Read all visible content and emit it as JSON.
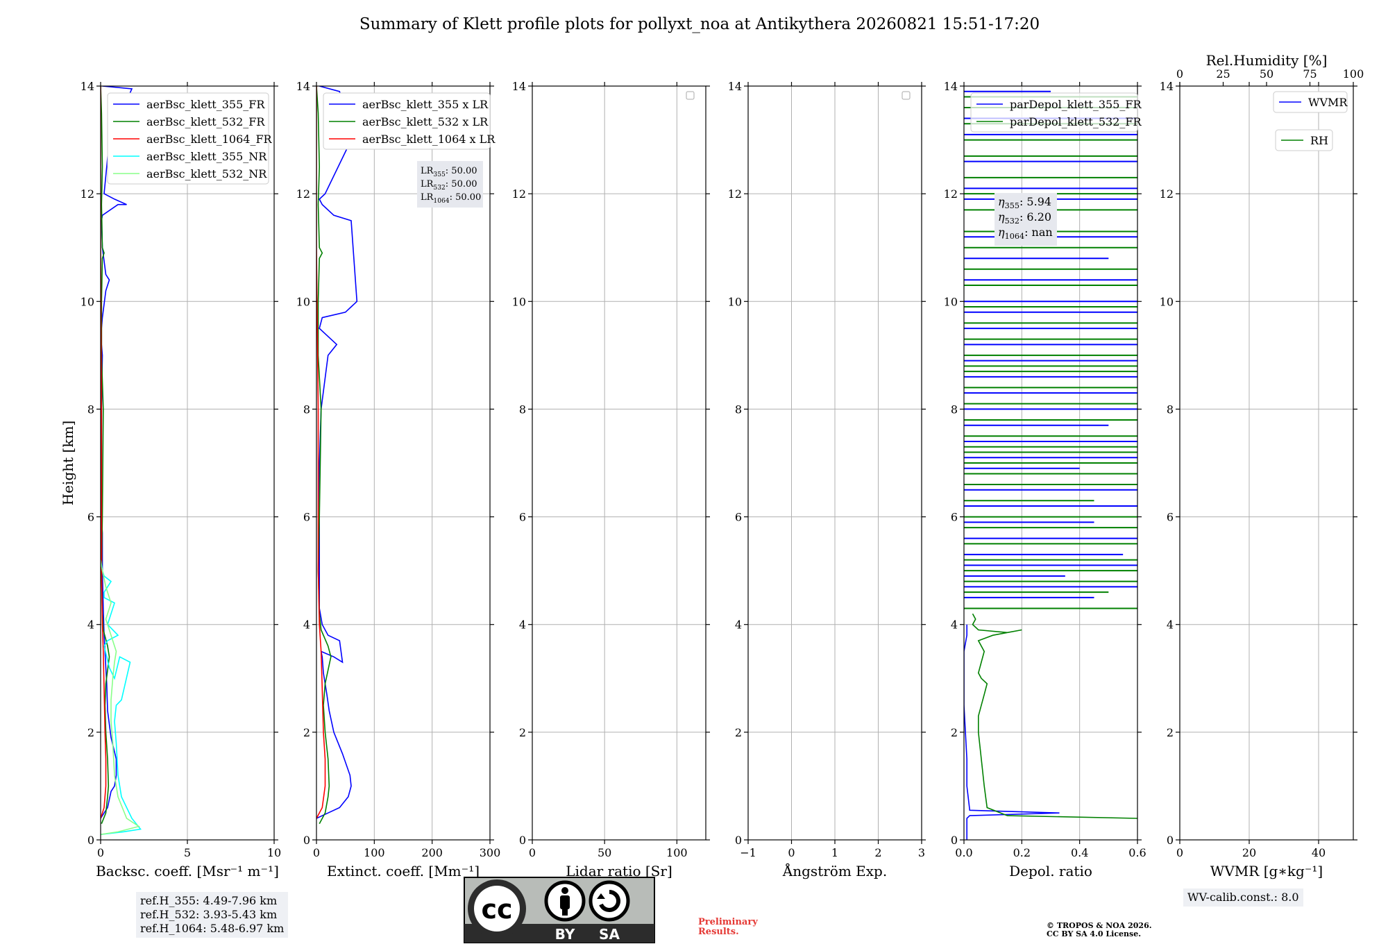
{
  "figure_title": "Summary of Klett profile plots for pollyxt_noa at Antikythera 20260821 15:51-17:20",
  "chart_data": [
    {
      "type": "line",
      "xlabel": "Backsc. coeff. [Msr⁻¹ m⁻¹]",
      "ylabel": "Height [km]",
      "xlim": [
        0,
        10
      ],
      "ylim": [
        0,
        14
      ],
      "xticks": [
        0,
        5,
        10
      ],
      "yticks": [
        0,
        2,
        4,
        6,
        8,
        10,
        12,
        14
      ],
      "grid": true,
      "legend": "top-right",
      "series": [
        {
          "name": "aerBsc_klett_355_FR",
          "color": "#0000ff",
          "x": [
            0.0,
            0.4,
            0.6,
            0.8,
            0.9,
            0.9,
            0.6,
            0.4,
            0.35,
            0.3,
            0.25,
            0.2,
            0.15,
            0.1,
            0.1,
            0.05,
            0.05,
            0.05,
            0.1,
            0.05,
            0.05,
            0.1,
            0.3,
            0.5,
            0.3,
            0.1,
            0.05,
            0.1,
            1.0,
            1.5,
            0.8,
            0.2,
            0.5,
            1.8,
            0.1
          ],
          "y": [
            0.4,
            0.6,
            0.9,
            1.0,
            1.2,
            1.5,
            1.9,
            2.4,
            2.9,
            3.2,
            3.5,
            3.8,
            4.3,
            5.0,
            5.7,
            6.0,
            7.0,
            8.0,
            9.0,
            9.2,
            9.5,
            9.7,
            10.2,
            10.4,
            10.5,
            11.0,
            11.5,
            11.6,
            11.8,
            11.8,
            11.9,
            12.0,
            13.0,
            13.95,
            14.0
          ]
        },
        {
          "name": "aerBsc_klett_532_FR",
          "color": "#008000",
          "x": [
            0.05,
            0.3,
            0.4,
            0.45,
            0.4,
            0.3,
            0.25,
            0.3,
            0.5,
            0.4,
            0.15,
            0.1,
            0.05,
            0.1,
            0.15,
            0.05,
            0.05,
            0.1,
            0.2,
            0.1,
            0.05,
            0.1,
            0.05,
            0.0
          ],
          "y": [
            0.3,
            0.5,
            0.8,
            1.0,
            1.5,
            2.0,
            2.5,
            2.9,
            3.4,
            3.6,
            3.9,
            4.2,
            5.0,
            6.0,
            8.0,
            9.0,
            10.0,
            10.8,
            10.9,
            11.0,
            11.8,
            12.5,
            13.5,
            14.0
          ]
        },
        {
          "name": "aerBsc_klett_1064_FR",
          "color": "#ff0000",
          "x": [
            0.0,
            0.2,
            0.3,
            0.3,
            0.25,
            0.2,
            0.15,
            0.1,
            0.05,
            0.05,
            0.0,
            0.0
          ],
          "y": [
            0.4,
            0.6,
            1.0,
            1.5,
            2.0,
            2.8,
            3.5,
            4.0,
            5.0,
            8.0,
            11.0,
            14.0
          ]
        },
        {
          "name": "aerBsc_klett_355_NR",
          "color": "#00ffff",
          "x": [
            0.0,
            1.3,
            2.3,
            1.8,
            1.2,
            1.0,
            0.9,
            0.8,
            0.9,
            1.2,
            1.7,
            1.1,
            0.8,
            0.5,
            0.2,
            0.4,
            1.0,
            0.4,
            0.8,
            0.2,
            0.2,
            0.6,
            0.2,
            0.1,
            0.0
          ],
          "y": [
            0.1,
            0.15,
            0.2,
            0.4,
            0.8,
            1.2,
            1.8,
            2.2,
            2.5,
            2.6,
            3.3,
            3.4,
            3.0,
            3.2,
            3.6,
            3.7,
            3.8,
            4.0,
            4.4,
            4.5,
            4.6,
            4.8,
            4.9,
            5.0,
            5.2
          ]
        },
        {
          "name": "aerBsc_klett_532_NR",
          "color": "#88ff88",
          "x": [
            0.0,
            1.0,
            2.2,
            1.5,
            1.0,
            0.8,
            0.7,
            0.6,
            0.6,
            0.7,
            0.8,
            0.9,
            0.7,
            0.5,
            0.3,
            0.6,
            0.3,
            0.1,
            0.0
          ],
          "y": [
            0.1,
            0.15,
            0.25,
            0.4,
            0.8,
            1.2,
            1.8,
            2.2,
            2.6,
            3.0,
            3.3,
            3.5,
            3.7,
            3.9,
            4.1,
            4.4,
            4.7,
            5.0,
            5.2
          ]
        }
      ],
      "footer_box": [
        "ref.H_355: 4.49-7.96 km",
        "ref.H_532: 3.93-5.43 km",
        "ref.H_1064: 5.48-6.97 km"
      ]
    },
    {
      "type": "line",
      "xlabel": "Extinct. coeff. [Mm⁻¹]",
      "ylabel": "",
      "xlim": [
        0,
        300
      ],
      "ylim": [
        0,
        14
      ],
      "xticks": [
        0,
        100,
        200,
        300
      ],
      "yticks": [
        0,
        2,
        4,
        6,
        8,
        10,
        12,
        14
      ],
      "grid": true,
      "legend": "top-right",
      "series": [
        {
          "name": "aerBsc_klett_355 x LR",
          "color": "#0000ff",
          "x": [
            0,
            20,
            40,
            55,
            60,
            58,
            45,
            30,
            22,
            18,
            15,
            12,
            10,
            8,
            30,
            45,
            40,
            20,
            10,
            5,
            5,
            5,
            5,
            8,
            20,
            35,
            15,
            5,
            10,
            50,
            70,
            60,
            30,
            10,
            5,
            15,
            60,
            40,
            5
          ],
          "y": [
            0.4,
            0.5,
            0.6,
            0.8,
            1.0,
            1.2,
            1.6,
            2.0,
            2.4,
            2.7,
            2.9,
            3.1,
            3.4,
            3.5,
            3.4,
            3.3,
            3.7,
            3.8,
            4.0,
            4.3,
            5.0,
            6.0,
            7.0,
            8.0,
            9.0,
            9.2,
            9.4,
            9.5,
            9.7,
            9.8,
            10.0,
            11.5,
            11.6,
            11.8,
            11.9,
            12.0,
            13.0,
            13.9,
            14.0
          ]
        },
        {
          "name": "aerBsc_klett_532 x LR",
          "color": "#008000",
          "x": [
            5,
            15,
            20,
            22,
            20,
            15,
            12,
            15,
            25,
            20,
            8,
            5,
            3,
            5,
            8,
            3,
            3,
            5,
            10,
            5,
            3,
            5,
            3,
            0
          ],
          "y": [
            0.3,
            0.5,
            0.8,
            1.0,
            1.5,
            2.0,
            2.5,
            2.9,
            3.4,
            3.6,
            3.9,
            4.2,
            5.0,
            6.0,
            8.0,
            9.0,
            10.0,
            10.8,
            10.9,
            11.0,
            11.8,
            12.5,
            13.5,
            14.0
          ]
        },
        {
          "name": "aerBsc_klett_1064 x LR",
          "color": "#ff0000",
          "x": [
            0,
            10,
            15,
            15,
            12,
            10,
            8,
            5,
            3,
            3,
            0,
            0
          ],
          "y": [
            0.4,
            0.6,
            1.0,
            1.5,
            2.0,
            2.8,
            3.5,
            4.0,
            5.0,
            8.0,
            11.0,
            14.0
          ]
        }
      ],
      "info_box": [
        {
          "sym": "LR",
          "sub": "355",
          "val": ": 50.00"
        },
        {
          "sym": "LR",
          "sub": "532",
          "val": ": 50.00"
        },
        {
          "sym": "LR",
          "sub": "1064",
          "val": ": 50.00"
        }
      ]
    },
    {
      "type": "line",
      "xlabel": "Lidar ratio [Sr]",
      "ylabel": "",
      "xlim": [
        0,
        120
      ],
      "ylim": [
        0,
        14
      ],
      "xticks": [
        0,
        50,
        100
      ],
      "yticks": [
        0,
        2,
        4,
        6,
        8,
        10,
        12,
        14
      ],
      "grid": true,
      "legend": "top-right",
      "series": []
    },
    {
      "type": "line",
      "xlabel": "Ångström Exp.",
      "ylabel": "",
      "xlim": [
        -1,
        3
      ],
      "ylim": [
        0,
        14
      ],
      "xticks": [
        -1,
        0,
        1,
        2,
        3
      ],
      "yticks": [
        0,
        2,
        4,
        6,
        8,
        10,
        12,
        14
      ],
      "grid": true,
      "legend": "top-right",
      "series": []
    },
    {
      "type": "line",
      "xlabel": "Depol. ratio",
      "ylabel": "",
      "xlim": [
        0,
        0.6
      ],
      "ylim": [
        0,
        14
      ],
      "xticks": [
        0.0,
        0.2,
        0.4,
        0.6
      ],
      "yticks": [
        0,
        2,
        4,
        6,
        8,
        10,
        12,
        14
      ],
      "grid": true,
      "legend": "top-right",
      "series": [
        {
          "name": "parDepol_klett_355_FR",
          "color": "#0000ff",
          "x": [
            0.01,
            0.01,
            0.01,
            0.02,
            0.33,
            0.02,
            0.01,
            0.01,
            0.0,
            0.0,
            0.01,
            0.01
          ],
          "y": [
            0.0,
            0.2,
            0.4,
            0.45,
            0.5,
            0.55,
            1.0,
            1.5,
            2.5,
            3.5,
            3.8,
            4.0
          ]
        },
        {
          "name": "parDepol_klett_532_FR",
          "color": "#008000",
          "x": [
            0.6,
            0.15,
            0.08,
            0.07,
            0.06,
            0.05,
            0.05,
            0.06,
            0.07,
            0.08,
            0.06,
            0.05,
            0.06,
            0.07,
            0.05,
            0.1,
            0.2,
            0.15,
            0.05,
            0.03,
            0.04,
            0.03
          ],
          "y": [
            0.4,
            0.45,
            0.6,
            1.0,
            1.5,
            2.0,
            2.3,
            2.5,
            2.7,
            2.9,
            3.0,
            3.1,
            3.3,
            3.5,
            3.7,
            3.8,
            3.9,
            3.85,
            3.9,
            4.0,
            4.1,
            4.2
          ]
        }
      ],
      "spikes": [
        {
          "series": "parDepol_klett_355_FR",
          "heights": [
            4.5,
            4.7,
            4.9,
            5.1,
            5.3,
            5.6,
            5.9,
            6.2,
            6.5,
            6.9,
            7.1,
            7.4,
            7.7,
            8.0,
            8.3,
            8.6,
            8.9,
            9.2,
            9.5,
            9.8,
            10.0,
            10.4,
            10.8,
            11.2,
            11.9,
            12.1,
            12.6,
            13.1,
            13.4,
            13.9
          ],
          "values": [
            0.45,
            0.6,
            0.35,
            0.6,
            0.55,
            0.6,
            0.45,
            0.6,
            0.6,
            0.4,
            0.6,
            0.6,
            0.5,
            0.6,
            0.6,
            0.6,
            0.6,
            0.6,
            0.6,
            0.6,
            0.6,
            0.6,
            0.5,
            0.6,
            0.6,
            0.6,
            0.6,
            0.6,
            0.6,
            0.3
          ]
        },
        {
          "series": "parDepol_klett_532_FR",
          "heights": [
            4.3,
            4.6,
            4.8,
            5.0,
            5.2,
            5.5,
            5.8,
            6.0,
            6.3,
            6.6,
            6.8,
            7.0,
            7.2,
            7.3,
            7.5,
            7.8,
            8.1,
            8.4,
            8.7,
            8.8,
            9.0,
            9.3,
            9.6,
            9.9,
            10.3,
            10.6,
            11.0,
            11.3,
            11.7,
            12.0,
            12.3,
            12.7,
            13.0,
            13.3,
            13.6,
            13.8
          ],
          "values": [
            0.6,
            0.5,
            0.6,
            0.6,
            0.6,
            0.6,
            0.6,
            0.6,
            0.45,
            0.6,
            0.6,
            0.6,
            0.6,
            0.6,
            0.6,
            0.6,
            0.6,
            0.6,
            0.6,
            0.6,
            0.6,
            0.6,
            0.6,
            0.6,
            0.6,
            0.6,
            0.6,
            0.6,
            0.6,
            0.6,
            0.6,
            0.6,
            0.6,
            0.6,
            0.6,
            0.6
          ]
        }
      ],
      "info_box": [
        {
          "sym": "η",
          "sub": "355",
          "val": ": 5.94"
        },
        {
          "sym": "η",
          "sub": "532",
          "val": ": 6.20"
        },
        {
          "sym": "η",
          "sub": "1064",
          "val": ": nan"
        }
      ]
    },
    {
      "type": "line",
      "xlabel": "WVMR [g∗kg⁻¹]",
      "ylabel": "",
      "xlim": [
        0,
        50
      ],
      "ylim": [
        0,
        14
      ],
      "xticks": [
        0,
        20,
        40
      ],
      "yticks": [
        0,
        2,
        4,
        6,
        8,
        10,
        12,
        14
      ],
      "top_xlabel": "Rel.Humidity [%]",
      "top_xlim": [
        0,
        100
      ],
      "top_xticks": [
        0,
        25,
        50,
        75,
        100
      ],
      "grid": true,
      "legends": [
        "WVMR",
        "RH"
      ],
      "legend_colors": [
        "#0000ff",
        "#008000"
      ],
      "series": [],
      "footer_box": "WV-calib.const.: 8.0"
    }
  ],
  "license": {
    "cc": "cc",
    "by": "BY",
    "sa": "SA",
    "preliminary": [
      "Preliminary",
      "Results."
    ],
    "copyright": [
      "© TROPOS & NOA 2026.",
      "CC BY SA 4.0 License."
    ]
  },
  "colors": {
    "blue": "#0000ff",
    "green": "#008000",
    "red": "#ff0000",
    "cyan": "#00ffff",
    "lightgreen": "#88ff88",
    "grid": "#b0b0b0"
  }
}
